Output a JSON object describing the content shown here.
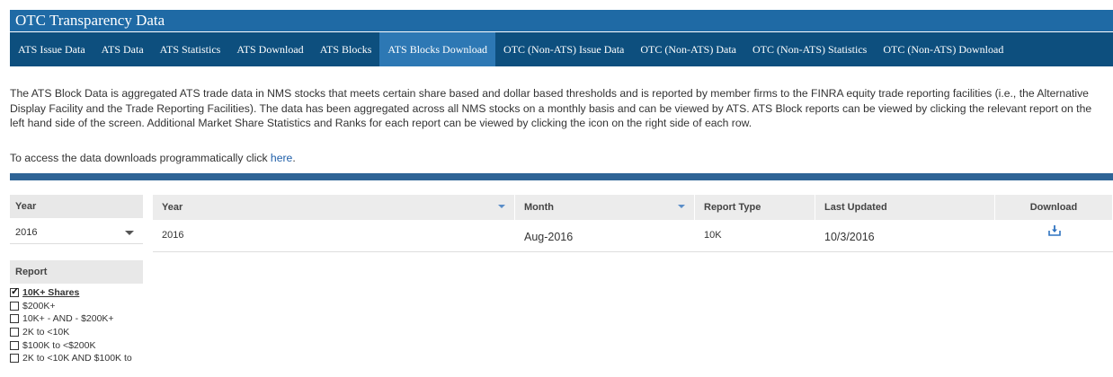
{
  "header": {
    "title": "OTC Transparency Data"
  },
  "nav": {
    "tabs": [
      {
        "label": "ATS Issue Data",
        "active": false
      },
      {
        "label": "ATS Data",
        "active": false
      },
      {
        "label": "ATS Statistics",
        "active": false
      },
      {
        "label": "ATS Download",
        "active": false
      },
      {
        "label": "ATS Blocks",
        "active": false
      },
      {
        "label": "ATS Blocks Download",
        "active": true
      },
      {
        "label": "OTC (Non-ATS) Issue Data",
        "active": false
      },
      {
        "label": "OTC (Non-ATS) Data",
        "active": false
      },
      {
        "label": "OTC (Non-ATS) Statistics",
        "active": false
      },
      {
        "label": "OTC (Non-ATS) Download",
        "active": false
      }
    ]
  },
  "intro": {
    "text": "The ATS Block Data is aggregated ATS trade data in NMS stocks that meets certain share based and dollar based thresholds and is reported by member firms to the FINRA equity trade reporting facilities (i.e., the Alternative Display Facility and the Trade Reporting Facilities). The data has been aggregated across all NMS stocks on a monthly basis and can be viewed by ATS. ATS Block reports can be viewed by clicking the relevant report on the left hand side of the screen. Additional Market Share Statistics and Ranks for each report can be viewed by clicking the icon on the right side of each row.",
    "access_prefix": "To access the data downloads programmatically click ",
    "access_link": "here",
    "access_suffix": "."
  },
  "sidebar": {
    "year_label": "Year",
    "year_value": "2016",
    "report_label": "Report",
    "reports": [
      {
        "label": "10K+ Shares",
        "checked": true
      },
      {
        "label": "$200K+",
        "checked": false
      },
      {
        "label": "10K+ - AND - $200K+",
        "checked": false
      },
      {
        "label": "2K to <10K",
        "checked": false
      },
      {
        "label": "$100K to <$200K",
        "checked": false
      },
      {
        "label": "2K to <10K AND $100K to",
        "checked": false
      }
    ]
  },
  "grid": {
    "columns": [
      "Year",
      "Month",
      "Report Type",
      "Last Updated",
      "Download"
    ],
    "rows": [
      {
        "year": "2016",
        "month": "Aug-2016",
        "report_type": "10K",
        "last_updated": "10/3/2016",
        "download_icon": "download-icon"
      }
    ]
  },
  "colors": {
    "title_bar": "#1f6aa5",
    "nav_bar": "#0d4f7e",
    "nav_active": "#2d78b4",
    "divider": "#2f6496",
    "link": "#1f5fa9"
  }
}
